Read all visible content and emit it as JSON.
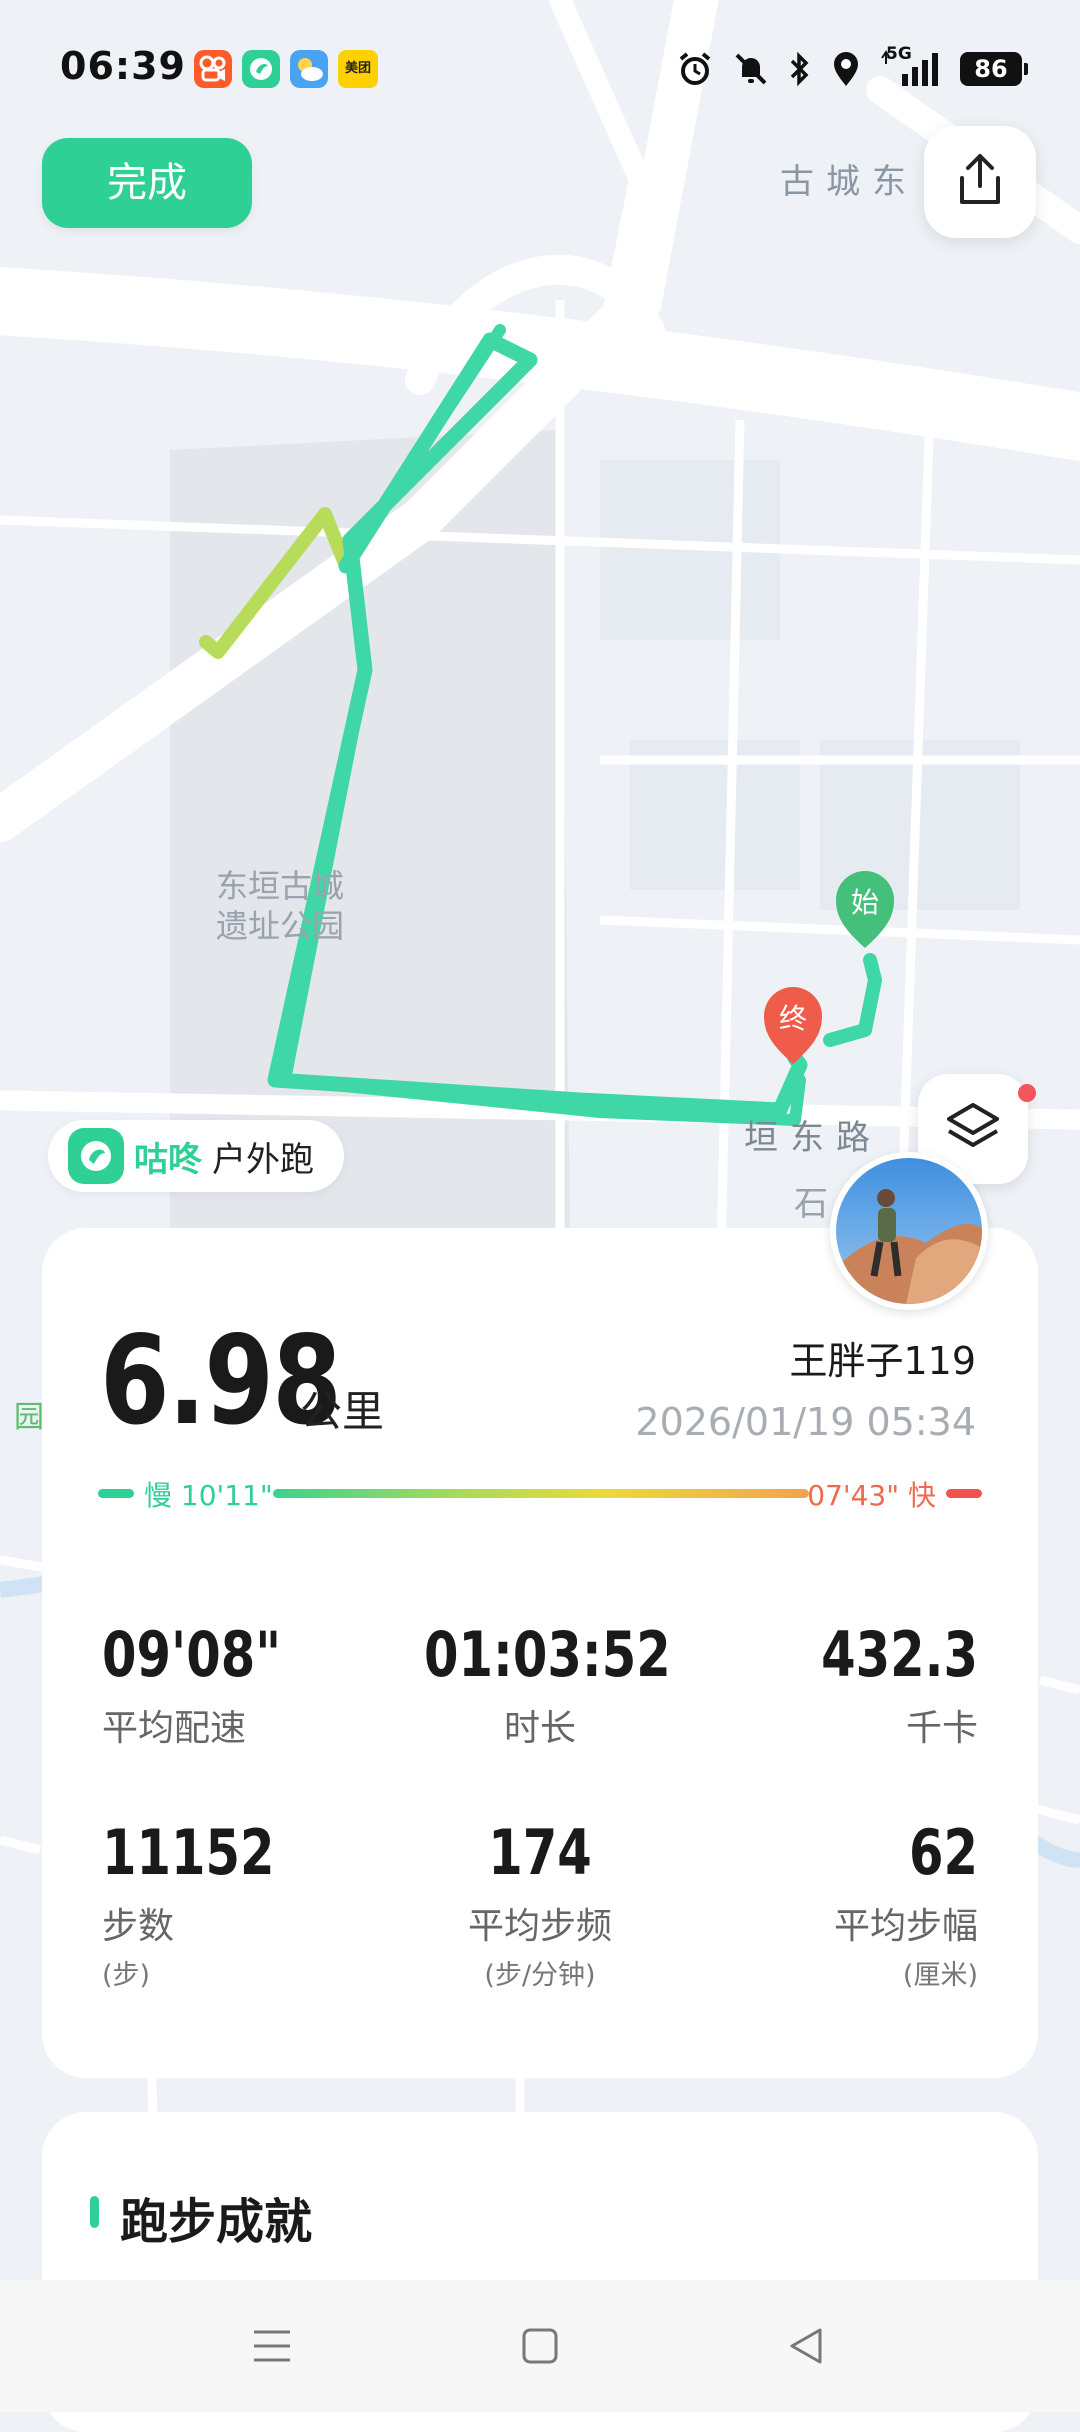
{
  "status_bar": {
    "time": "06:39",
    "app_icons": [
      "kuaishou-icon",
      "gudong-icon",
      "weather-icon",
      "meituan-icon"
    ],
    "meituan_label": "美团",
    "indicators": [
      "alarm-icon",
      "mute-icon",
      "bluetooth-icon",
      "location-icon",
      "5g-signal-icon"
    ],
    "network": "5G",
    "battery": "86"
  },
  "header": {
    "done_label": "完成",
    "share_icon": "share-icon"
  },
  "map": {
    "labels": {
      "top_street": "古城东",
      "park": [
        "东垣古城",
        "遗址公园"
      ],
      "road": "垣东路",
      "road_partial": "石",
      "left_edge": "园"
    },
    "start_marker": "始",
    "end_marker": "终",
    "route_colors": {
      "main": "#3fd7a6",
      "fast": "#b7dc5a"
    },
    "layers_icon": "layers-icon"
  },
  "brand": {
    "name": "咕咚",
    "run_type": "户外跑"
  },
  "summary": {
    "distance": "6.98",
    "distance_unit": "公里",
    "user_name": "王胖子119",
    "datetime": "2026/01/19 05:34",
    "pace_slow_label": "慢 10'11\"",
    "pace_fast_label": "07'43\" 快",
    "accent_color": "#2fd095"
  },
  "metrics": [
    {
      "value": "09'08\"",
      "label": "平均配速"
    },
    {
      "value": "01:03:52",
      "label": "时长"
    },
    {
      "value": "432.3",
      "label": "千卡"
    },
    {
      "value": "11152",
      "label": "步数",
      "unit": "(步)"
    },
    {
      "value": "174",
      "label": "平均步频",
      "unit": "(步/分钟)"
    },
    {
      "value": "62",
      "label": "平均步幅",
      "unit": "(厘米)"
    }
  ],
  "achievements": {
    "title": "跑步成就"
  },
  "nav": {
    "menu_icon": "menu-icon",
    "home_icon": "home-icon",
    "back_icon": "back-icon"
  }
}
